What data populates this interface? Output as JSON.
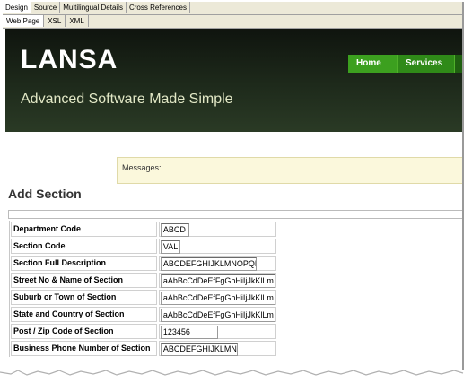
{
  "tabs": [
    "Design",
    "Source",
    "Multilingual Details",
    "Cross References"
  ],
  "subtabs": [
    "Web Page",
    "XSL",
    "XML"
  ],
  "header": {
    "brand": "LANSA",
    "tagline": "Advanced Software Made Simple",
    "nav": [
      "Home",
      "Services"
    ]
  },
  "messages_label": "Messages:",
  "section_title": "Add Section",
  "form": [
    {
      "label": "Department Code",
      "value": "ABCD"
    },
    {
      "label": "Section Code",
      "value": "VALI"
    },
    {
      "label": "Section Full Description",
      "value": "ABCDEFGHIJKLMNOPQRS"
    },
    {
      "label": "Street No & Name of Section",
      "value": "aAbBcCdDeEfFgGhHiIjJkKlLm"
    },
    {
      "label": "Suburb or Town of Section",
      "value": "aAbBcCdDeEfFgGhHiIjJkKlLm"
    },
    {
      "label": "State and Country of Section",
      "value": "aAbBcCdDeEfFgGhHiIjJkKlLm"
    },
    {
      "label": "Post / Zip Code of Section",
      "value": "123456"
    },
    {
      "label": "Business Phone Number of Section",
      "value": "ABCDEFGHIJKLMNO"
    }
  ]
}
